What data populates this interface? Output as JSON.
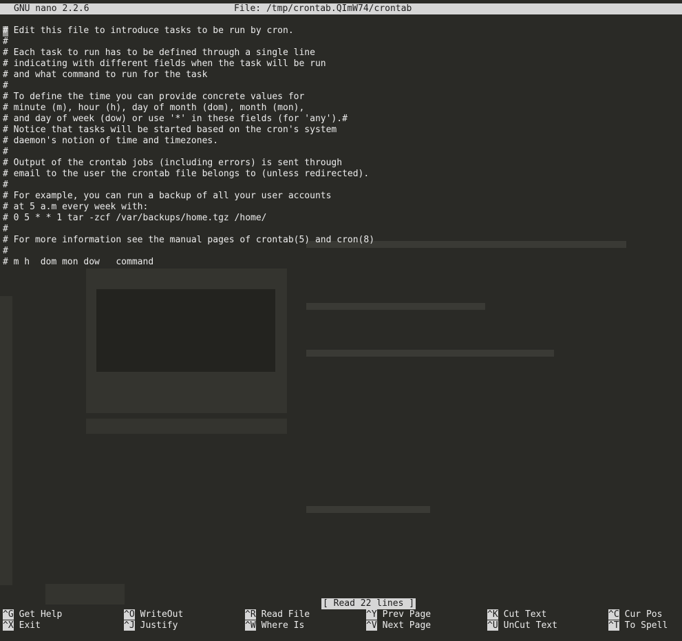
{
  "title_bar": {
    "app_version": "GNU nano 2.2.6",
    "file": "File: /tmp/crontab.QImW74/crontab"
  },
  "editor": {
    "lines": [
      "# Edit this file to introduce tasks to be run by cron.",
      "#",
      "# Each task to run has to be defined through a single line",
      "# indicating with different fields when the task will be run",
      "# and what command to run for the task",
      "#",
      "# To define the time you can provide concrete values for",
      "# minute (m), hour (h), day of month (dom), month (mon),",
      "# and day of week (dow) or use '*' in these fields (for 'any').#",
      "# Notice that tasks will be started based on the cron's system",
      "# daemon's notion of time and timezones.",
      "#",
      "# Output of the crontab jobs (including errors) is sent through",
      "# email to the user the crontab file belongs to (unless redirected).",
      "#",
      "# For example, you can run a backup of all your user accounts",
      "# at 5 a.m every week with:",
      "# 0 5 * * 1 tar -zcf /var/backups/home.tgz /home/",
      "#",
      "# For more information see the manual pages of crontab(5) and cron(8)",
      "#",
      "# m h  dom mon dow   command"
    ]
  },
  "status_message": "[ Read 22 lines ]",
  "shortcuts": [
    {
      "key": "^G",
      "label": "Get Help"
    },
    {
      "key": "^O",
      "label": "WriteOut"
    },
    {
      "key": "^R",
      "label": "Read File"
    },
    {
      "key": "^Y",
      "label": "Prev Page"
    },
    {
      "key": "^K",
      "label": "Cut Text"
    },
    {
      "key": "^C",
      "label": "Cur Pos"
    },
    {
      "key": "^X",
      "label": "Exit"
    },
    {
      "key": "^J",
      "label": "Justify"
    },
    {
      "key": "^W",
      "label": "Where Is"
    },
    {
      "key": "^V",
      "label": "Next Page"
    },
    {
      "key": "^U",
      "label": "UnCut Text"
    },
    {
      "key": "^T",
      "label": "To Spell"
    }
  ],
  "colors": {
    "background": "#2a2a26",
    "text": "#ececec",
    "inverse_bg": "#d6d6d6",
    "inverse_fg": "#1a1a1a"
  }
}
